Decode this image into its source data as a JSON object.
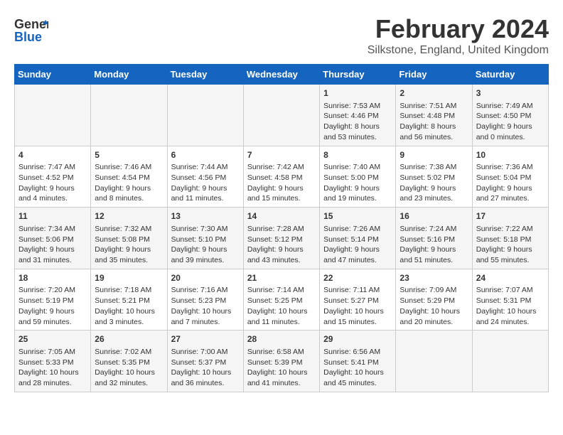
{
  "header": {
    "logo_line1": "General",
    "logo_line2": "Blue",
    "title": "February 2024",
    "subtitle": "Silkstone, England, United Kingdom"
  },
  "days_of_week": [
    "Sunday",
    "Monday",
    "Tuesday",
    "Wednesday",
    "Thursday",
    "Friday",
    "Saturday"
  ],
  "weeks": [
    [
      {
        "day": "",
        "content": ""
      },
      {
        "day": "",
        "content": ""
      },
      {
        "day": "",
        "content": ""
      },
      {
        "day": "",
        "content": ""
      },
      {
        "day": "1",
        "content": "Sunrise: 7:53 AM\nSunset: 4:46 PM\nDaylight: 8 hours and 53 minutes."
      },
      {
        "day": "2",
        "content": "Sunrise: 7:51 AM\nSunset: 4:48 PM\nDaylight: 8 hours and 56 minutes."
      },
      {
        "day": "3",
        "content": "Sunrise: 7:49 AM\nSunset: 4:50 PM\nDaylight: 9 hours and 0 minutes."
      }
    ],
    [
      {
        "day": "4",
        "content": "Sunrise: 7:47 AM\nSunset: 4:52 PM\nDaylight: 9 hours and 4 minutes."
      },
      {
        "day": "5",
        "content": "Sunrise: 7:46 AM\nSunset: 4:54 PM\nDaylight: 9 hours and 8 minutes."
      },
      {
        "day": "6",
        "content": "Sunrise: 7:44 AM\nSunset: 4:56 PM\nDaylight: 9 hours and 11 minutes."
      },
      {
        "day": "7",
        "content": "Sunrise: 7:42 AM\nSunset: 4:58 PM\nDaylight: 9 hours and 15 minutes."
      },
      {
        "day": "8",
        "content": "Sunrise: 7:40 AM\nSunset: 5:00 PM\nDaylight: 9 hours and 19 minutes."
      },
      {
        "day": "9",
        "content": "Sunrise: 7:38 AM\nSunset: 5:02 PM\nDaylight: 9 hours and 23 minutes."
      },
      {
        "day": "10",
        "content": "Sunrise: 7:36 AM\nSunset: 5:04 PM\nDaylight: 9 hours and 27 minutes."
      }
    ],
    [
      {
        "day": "11",
        "content": "Sunrise: 7:34 AM\nSunset: 5:06 PM\nDaylight: 9 hours and 31 minutes."
      },
      {
        "day": "12",
        "content": "Sunrise: 7:32 AM\nSunset: 5:08 PM\nDaylight: 9 hours and 35 minutes."
      },
      {
        "day": "13",
        "content": "Sunrise: 7:30 AM\nSunset: 5:10 PM\nDaylight: 9 hours and 39 minutes."
      },
      {
        "day": "14",
        "content": "Sunrise: 7:28 AM\nSunset: 5:12 PM\nDaylight: 9 hours and 43 minutes."
      },
      {
        "day": "15",
        "content": "Sunrise: 7:26 AM\nSunset: 5:14 PM\nDaylight: 9 hours and 47 minutes."
      },
      {
        "day": "16",
        "content": "Sunrise: 7:24 AM\nSunset: 5:16 PM\nDaylight: 9 hours and 51 minutes."
      },
      {
        "day": "17",
        "content": "Sunrise: 7:22 AM\nSunset: 5:18 PM\nDaylight: 9 hours and 55 minutes."
      }
    ],
    [
      {
        "day": "18",
        "content": "Sunrise: 7:20 AM\nSunset: 5:19 PM\nDaylight: 9 hours and 59 minutes."
      },
      {
        "day": "19",
        "content": "Sunrise: 7:18 AM\nSunset: 5:21 PM\nDaylight: 10 hours and 3 minutes."
      },
      {
        "day": "20",
        "content": "Sunrise: 7:16 AM\nSunset: 5:23 PM\nDaylight: 10 hours and 7 minutes."
      },
      {
        "day": "21",
        "content": "Sunrise: 7:14 AM\nSunset: 5:25 PM\nDaylight: 10 hours and 11 minutes."
      },
      {
        "day": "22",
        "content": "Sunrise: 7:11 AM\nSunset: 5:27 PM\nDaylight: 10 hours and 15 minutes."
      },
      {
        "day": "23",
        "content": "Sunrise: 7:09 AM\nSunset: 5:29 PM\nDaylight: 10 hours and 20 minutes."
      },
      {
        "day": "24",
        "content": "Sunrise: 7:07 AM\nSunset: 5:31 PM\nDaylight: 10 hours and 24 minutes."
      }
    ],
    [
      {
        "day": "25",
        "content": "Sunrise: 7:05 AM\nSunset: 5:33 PM\nDaylight: 10 hours and 28 minutes."
      },
      {
        "day": "26",
        "content": "Sunrise: 7:02 AM\nSunset: 5:35 PM\nDaylight: 10 hours and 32 minutes."
      },
      {
        "day": "27",
        "content": "Sunrise: 7:00 AM\nSunset: 5:37 PM\nDaylight: 10 hours and 36 minutes."
      },
      {
        "day": "28",
        "content": "Sunrise: 6:58 AM\nSunset: 5:39 PM\nDaylight: 10 hours and 41 minutes."
      },
      {
        "day": "29",
        "content": "Sunrise: 6:56 AM\nSunset: 5:41 PM\nDaylight: 10 hours and 45 minutes."
      },
      {
        "day": "",
        "content": ""
      },
      {
        "day": "",
        "content": ""
      }
    ]
  ]
}
